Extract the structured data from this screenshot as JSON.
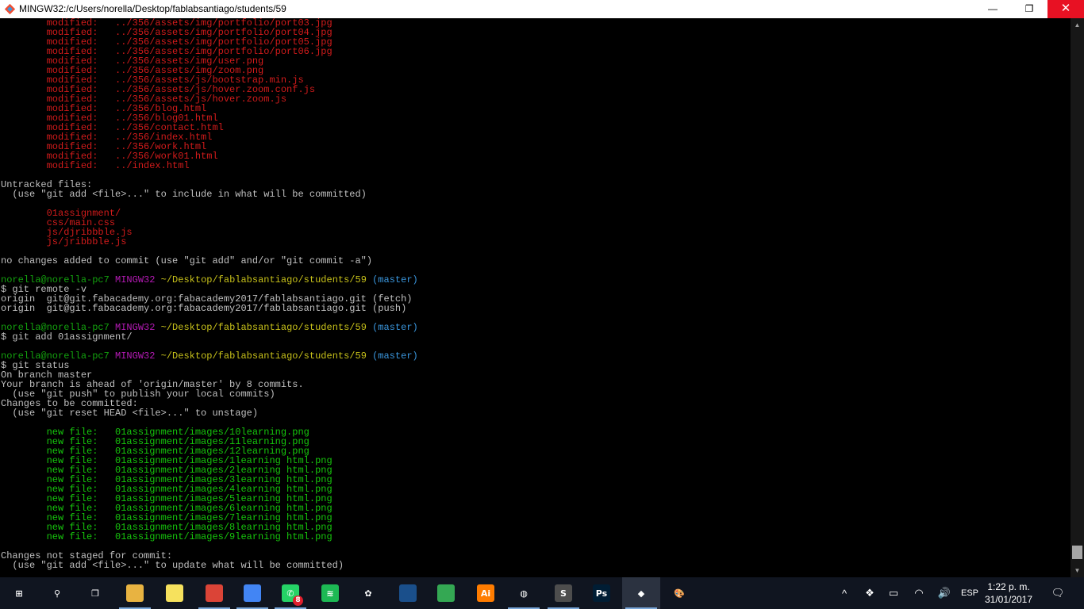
{
  "window": {
    "title": "MINGW32:/c/Users/norella/Desktop/fablabsantiago/students/59",
    "minimize_glyph": "—",
    "maximize_glyph": "❐",
    "close_glyph": "✕"
  },
  "terminal": {
    "lines": [
      [
        {
          "t": "        modified:   ../356/assets/img/portfolio/port03.jpg",
          "c": "red"
        }
      ],
      [
        {
          "t": "        modified:   ../356/assets/img/portfolio/port04.jpg",
          "c": "red"
        }
      ],
      [
        {
          "t": "        modified:   ../356/assets/img/portfolio/port05.jpg",
          "c": "red"
        }
      ],
      [
        {
          "t": "        modified:   ../356/assets/img/portfolio/port06.jpg",
          "c": "red"
        }
      ],
      [
        {
          "t": "        modified:   ../356/assets/img/user.png",
          "c": "red"
        }
      ],
      [
        {
          "t": "        modified:   ../356/assets/img/zoom.png",
          "c": "red"
        }
      ],
      [
        {
          "t": "        modified:   ../356/assets/js/bootstrap.min.js",
          "c": "red"
        }
      ],
      [
        {
          "t": "        modified:   ../356/assets/js/hover.zoom.conf.js",
          "c": "red"
        }
      ],
      [
        {
          "t": "        modified:   ../356/assets/js/hover.zoom.js",
          "c": "red"
        }
      ],
      [
        {
          "t": "        modified:   ../356/blog.html",
          "c": "red"
        }
      ],
      [
        {
          "t": "        modified:   ../356/blog01.html",
          "c": "red"
        }
      ],
      [
        {
          "t": "        modified:   ../356/contact.html",
          "c": "red"
        }
      ],
      [
        {
          "t": "        modified:   ../356/index.html",
          "c": "red"
        }
      ],
      [
        {
          "t": "        modified:   ../356/work.html",
          "c": "red"
        }
      ],
      [
        {
          "t": "        modified:   ../356/work01.html",
          "c": "red"
        }
      ],
      [
        {
          "t": "        modified:   ../index.html",
          "c": "red"
        }
      ],
      [],
      [
        {
          "t": "Untracked files:"
        }
      ],
      [
        {
          "t": "  (use \"git add <file>...\" to include in what will be committed)"
        }
      ],
      [],
      [
        {
          "t": "        01assignment/",
          "c": "red"
        }
      ],
      [
        {
          "t": "        css/main.css",
          "c": "red"
        }
      ],
      [
        {
          "t": "        js/djribbble.js",
          "c": "red"
        }
      ],
      [
        {
          "t": "        js/jribbble.js",
          "c": "red"
        }
      ],
      [],
      [
        {
          "t": "no changes added to commit (use \"git add\" and/or \"git commit -a\")"
        }
      ],
      [],
      [
        {
          "t": "norella@norella-pc7",
          "c": "user"
        },
        {
          "t": " "
        },
        {
          "t": "MINGW32",
          "c": "host"
        },
        {
          "t": " "
        },
        {
          "t": "~/Desktop/fablabsantiago/students/59",
          "c": "path"
        },
        {
          "t": " "
        },
        {
          "t": "(master)",
          "c": "branch"
        }
      ],
      [
        {
          "t": "$ git remote -v"
        }
      ],
      [
        {
          "t": "origin  git@git.fabacademy.org:fabacademy2017/fablabsantiago.git (fetch)"
        }
      ],
      [
        {
          "t": "origin  git@git.fabacademy.org:fabacademy2017/fablabsantiago.git (push)"
        }
      ],
      [],
      [
        {
          "t": "norella@norella-pc7",
          "c": "user"
        },
        {
          "t": " "
        },
        {
          "t": "MINGW32",
          "c": "host"
        },
        {
          "t": " "
        },
        {
          "t": "~/Desktop/fablabsantiago/students/59",
          "c": "path"
        },
        {
          "t": " "
        },
        {
          "t": "(master)",
          "c": "branch"
        }
      ],
      [
        {
          "t": "$ git add 01assignment/"
        }
      ],
      [],
      [
        {
          "t": "norella@norella-pc7",
          "c": "user"
        },
        {
          "t": " "
        },
        {
          "t": "MINGW32",
          "c": "host"
        },
        {
          "t": " "
        },
        {
          "t": "~/Desktop/fablabsantiago/students/59",
          "c": "path"
        },
        {
          "t": " "
        },
        {
          "t": "(master)",
          "c": "branch"
        }
      ],
      [
        {
          "t": "$ git status"
        }
      ],
      [
        {
          "t": "On branch master"
        }
      ],
      [
        {
          "t": "Your branch is ahead of 'origin/master' by 8 commits."
        }
      ],
      [
        {
          "t": "  (use \"git push\" to publish your local commits)"
        }
      ],
      [
        {
          "t": "Changes to be committed:"
        }
      ],
      [
        {
          "t": "  (use \"git reset HEAD <file>...\" to unstage)"
        }
      ],
      [],
      [
        {
          "t": "        new file:   01assignment/images/10learning.png",
          "c": "green"
        }
      ],
      [
        {
          "t": "        new file:   01assignment/images/11learning.png",
          "c": "green"
        }
      ],
      [
        {
          "t": "        new file:   01assignment/images/12learning.png",
          "c": "green"
        }
      ],
      [
        {
          "t": "        new file:   01assignment/images/1learning html.png",
          "c": "green"
        }
      ],
      [
        {
          "t": "        new file:   01assignment/images/2learning html.png",
          "c": "green"
        }
      ],
      [
        {
          "t": "        new file:   01assignment/images/3learning html.png",
          "c": "green"
        }
      ],
      [
        {
          "t": "        new file:   01assignment/images/4learning html.png",
          "c": "green"
        }
      ],
      [
        {
          "t": "        new file:   01assignment/images/5learning html.png",
          "c": "green"
        }
      ],
      [
        {
          "t": "        new file:   01assignment/images/6learning html.png",
          "c": "green"
        }
      ],
      [
        {
          "t": "        new file:   01assignment/images/7learning html.png",
          "c": "green"
        }
      ],
      [
        {
          "t": "        new file:   01assignment/images/8learning html.png",
          "c": "green"
        }
      ],
      [
        {
          "t": "        new file:   01assignment/images/9learning html.png",
          "c": "green"
        }
      ],
      [],
      [
        {
          "t": "Changes not staged for commit:"
        }
      ],
      [
        {
          "t": "  (use \"git add <file>...\" to update what will be committed)"
        }
      ]
    ]
  },
  "taskbar": {
    "items": [
      {
        "name": "start-button",
        "icon": "windows-logo-icon",
        "glyph": "⊞",
        "bg": "transparent",
        "interactable": true
      },
      {
        "name": "search-button",
        "icon": "search-icon",
        "glyph": "⚲",
        "bg": "transparent",
        "interactable": true
      },
      {
        "name": "task-view-button",
        "icon": "task-view-icon",
        "glyph": "❐",
        "bg": "transparent",
        "interactable": true
      },
      {
        "name": "taskbar-file-explorer",
        "icon": "folder-icon",
        "glyph": "",
        "bg": "#e8b341",
        "interactable": true,
        "underline": true
      },
      {
        "name": "taskbar-sticky-notes",
        "icon": "sticky-note-icon",
        "glyph": "",
        "bg": "#f6e15d",
        "interactable": true
      },
      {
        "name": "taskbar-chrome-app-1",
        "icon": "chrome-icon",
        "glyph": "",
        "bg": "#db4437",
        "interactable": true,
        "underline": true
      },
      {
        "name": "taskbar-chrome-app-2",
        "icon": "chrome-icon",
        "glyph": "",
        "bg": "#4285f4",
        "interactable": true,
        "underline": true
      },
      {
        "name": "taskbar-whatsapp",
        "icon": "whatsapp-icon",
        "glyph": "✆",
        "bg": "#25d366",
        "interactable": true,
        "badge": "8",
        "underline": true
      },
      {
        "name": "taskbar-spotify",
        "icon": "spotify-icon",
        "glyph": "≋",
        "bg": "#1db954",
        "interactable": true
      },
      {
        "name": "taskbar-app-mascot",
        "icon": "mascot-icon",
        "glyph": "✿",
        "bg": "transparent",
        "interactable": true
      },
      {
        "name": "taskbar-kindle",
        "icon": "kindle-icon",
        "glyph": "",
        "bg": "#1a4f8b",
        "interactable": true
      },
      {
        "name": "taskbar-chrome",
        "icon": "chrome-icon",
        "glyph": "",
        "bg": "#34a853",
        "interactable": true
      },
      {
        "name": "taskbar-illustrator",
        "icon": "illustrator-icon",
        "glyph": "Ai",
        "bg": "#ff7c00",
        "interactable": true
      },
      {
        "name": "taskbar-inkscape",
        "icon": "inkscape-icon",
        "glyph": "◍",
        "bg": "transparent",
        "interactable": true,
        "underline": true
      },
      {
        "name": "taskbar-sublime-text",
        "icon": "sublime-text-icon",
        "glyph": "S",
        "bg": "#4d4d4d",
        "interactable": true,
        "underline": true
      },
      {
        "name": "taskbar-photoshop",
        "icon": "photoshop-icon",
        "glyph": "Ps",
        "bg": "#001d34",
        "interactable": true
      },
      {
        "name": "taskbar-git-bash",
        "icon": "git-icon",
        "glyph": "◆",
        "bg": "transparent",
        "interactable": true,
        "active": true,
        "underline": true
      },
      {
        "name": "taskbar-paint",
        "icon": "paint-palette-icon",
        "glyph": "🎨",
        "bg": "transparent",
        "interactable": true
      }
    ],
    "tray": [
      {
        "name": "show-hidden-icons-button",
        "icon": "chevron-up-icon",
        "glyph": "^"
      },
      {
        "name": "dropbox-tray",
        "icon": "dropbox-icon",
        "glyph": "❖"
      },
      {
        "name": "battery-tray",
        "icon": "battery-icon",
        "glyph": "▭"
      },
      {
        "name": "wifi-tray",
        "icon": "wifi-icon",
        "glyph": "◠"
      },
      {
        "name": "volume-tray",
        "icon": "volume-icon",
        "glyph": "🔊"
      },
      {
        "name": "language-tray",
        "icon": "",
        "glyph": "ESP"
      }
    ],
    "clock": {
      "time": "1:22 p. m.",
      "date": "31/01/2017"
    },
    "notifications_glyph": "🗨"
  }
}
